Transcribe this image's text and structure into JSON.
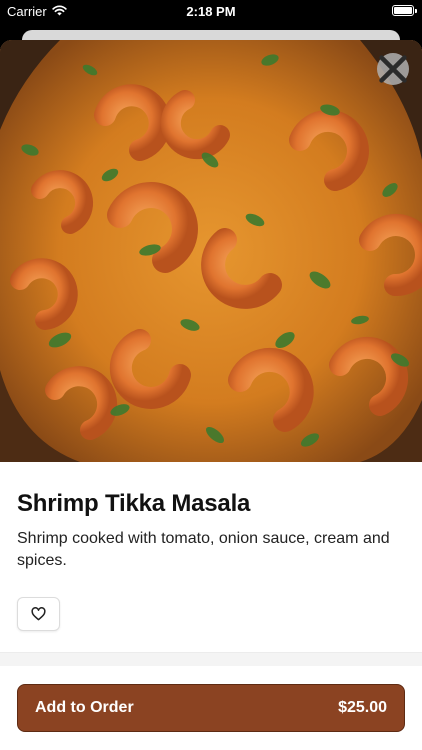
{
  "status_bar": {
    "carrier": "Carrier",
    "time": "2:18 PM",
    "wifi_icon": "wifi-icon",
    "battery_icon": "battery-icon"
  },
  "item": {
    "image_alt": "Shrimp Tikka Masala dish",
    "title": "Shrimp Tikka Masala",
    "description": "Shrimp cooked with tomato, onion sauce, cream and spices."
  },
  "actions": {
    "close_icon": "close-icon",
    "favorite_icon": "heart-icon",
    "add_label": "Add to Order",
    "price": "$25.00"
  },
  "colors": {
    "accent": "#8b4322",
    "accent_border": "#5e2a12"
  }
}
